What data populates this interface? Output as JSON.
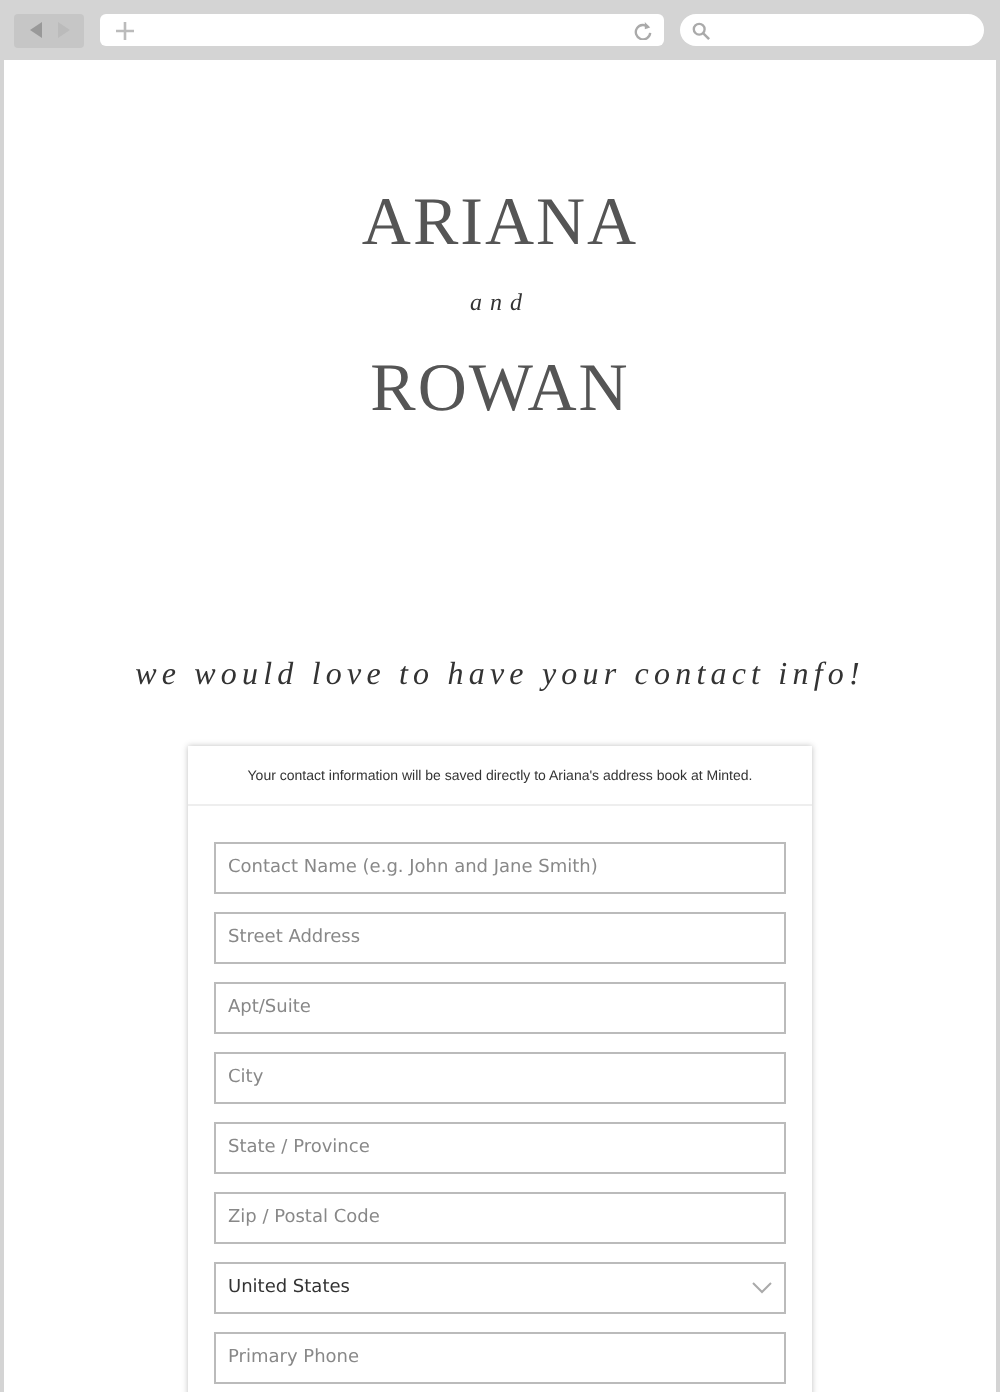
{
  "names": {
    "first": "ARIANA",
    "joiner": "and",
    "second": "ROWAN"
  },
  "tagline": "we would love to have your contact info!",
  "form": {
    "notice": "Your contact information will be saved directly to Ariana's address book at Minted.",
    "fields": [
      {
        "kind": "text",
        "placeholder": "Contact Name (e.g. John and Jane Smith)"
      },
      {
        "kind": "text",
        "placeholder": "Street Address"
      },
      {
        "kind": "text",
        "placeholder": "Apt/Suite"
      },
      {
        "kind": "text",
        "placeholder": "City"
      },
      {
        "kind": "text",
        "placeholder": "State / Province"
      },
      {
        "kind": "text",
        "placeholder": "Zip / Postal Code"
      },
      {
        "kind": "select",
        "value": "United States"
      },
      {
        "kind": "text",
        "placeholder": "Primary Phone"
      }
    ]
  }
}
